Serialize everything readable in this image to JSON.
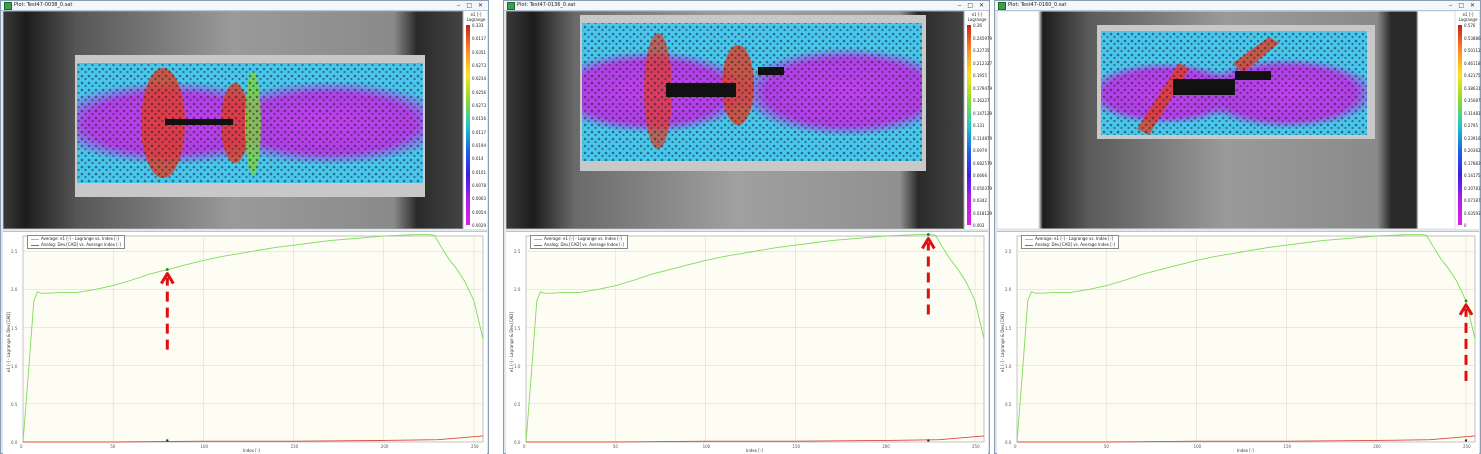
{
  "colors": {
    "curve": "#7fdc5a",
    "curve2": "#d94a3a",
    "arrow": "#e01010",
    "plot_bg": "#fdfdf4"
  },
  "panels": [
    {
      "window_title": "Plot: Test47-0038_0.sat",
      "legend": {
        "title": "e1 [-]",
        "subtitle": "Lagrange",
        "ticks": [
          "0.333",
          "0.0117",
          "0.0351",
          "0.0273",
          "0.0234",
          "0.0256",
          "0.0273",
          "0.0156",
          "0.0117",
          "0.0194",
          "0.014",
          "0.0101",
          "0.0078",
          "0.0063",
          "0.0054",
          "0.0029"
        ]
      },
      "plot": {
        "legend": [
          "Average: e1 [-] - Lagrange vs. Index [-]",
          "Analog: Dev.[CAD] vs. Average Index [-]"
        ],
        "ylabel": "e1 [-] - Lagrange & Dev.[CAD]",
        "xlabel": "Index [-]",
        "yticks": [
          "2.5",
          "2.0",
          "1.5",
          "1.0",
          "0.5",
          "0.0"
        ],
        "xticks": [
          "0",
          "50",
          "100",
          "150",
          "200",
          "250"
        ],
        "marker_index": 80
      }
    },
    {
      "window_title": "Plot: Test47-0136_0.sat",
      "legend": {
        "title": "e1 [-]",
        "subtitle": "Lagrange",
        "ticks": [
          "0.26",
          "0.245979",
          "0.22735",
          "0.212327",
          "0.1955",
          "0.179479",
          "0.16227",
          "0.147129",
          "0.131",
          "0.114879",
          "0.0979",
          "0.082579",
          "0.0666",
          "0.050379",
          "0.0342",
          "0.018129",
          "0.003"
        ]
      },
      "plot": {
        "legend": [
          "Average: e1 [-] - Lagrange vs. Index [-]",
          "Analog: Dev.[CAD] vs. Average Index [-]"
        ],
        "ylabel": "e1 [-] - Lagrange & Dev.[CAD]",
        "xlabel": "Index [-]",
        "yticks": [
          "2.5",
          "2.0",
          "1.5",
          "1.0",
          "0.5",
          "0.0"
        ],
        "xticks": [
          "0",
          "50",
          "100",
          "150",
          "200",
          "250"
        ],
        "marker_index": 224
      }
    },
    {
      "window_title": "Plot: Test47-0160_0.sat",
      "legend": {
        "title": "e1 [-]",
        "subtitle": "Lagrange",
        "ticks": [
          "0.576",
          "0.538862",
          "0.501125",
          "0.461187",
          "0.42175",
          "0.386312",
          "0.350875",
          "0.314837",
          "0.2795",
          "0.239162",
          "0.203625",
          "0.178839",
          "0.14175",
          "0.107812",
          "0.071875",
          "0.035937",
          "0"
        ]
      },
      "plot": {
        "legend": [
          "Average: e1 [-] - Lagrange vs. Index [-]",
          "Analog: Dev.[CAD] vs. Average Index [-]"
        ],
        "ylabel": "e1 [-] - Lagrange & Dev.[CAD]",
        "xlabel": "Index [-]",
        "yticks": [
          "2.5",
          "2.0",
          "1.5",
          "1.0",
          "0.5",
          "0.0"
        ],
        "xticks": [
          "0",
          "50",
          "100",
          "150",
          "200",
          "250"
        ],
        "marker_index": 250
      }
    }
  ],
  "chart_data": {
    "type": "line",
    "xlabel": "Index [-]",
    "ylabel": "e1 [-] - Lagrange & Dev.[CAD]",
    "xlim": [
      0,
      255
    ],
    "ylim": [
      0,
      2.7
    ],
    "series": [
      {
        "name": "Average: e1 [-] - Lagrange vs. Index [-]",
        "x": [
          0,
          3,
          6,
          8,
          10,
          15,
          20,
          30,
          40,
          50,
          60,
          70,
          80,
          90,
          100,
          110,
          120,
          130,
          140,
          150,
          160,
          170,
          180,
          190,
          200,
          210,
          220,
          225,
          228,
          232,
          236,
          240,
          245,
          250,
          255
        ],
        "y": [
          0.0,
          0.9,
          1.85,
          1.97,
          1.95,
          1.95,
          1.96,
          1.96,
          2.0,
          2.05,
          2.12,
          2.2,
          2.26,
          2.32,
          2.38,
          2.43,
          2.47,
          2.51,
          2.55,
          2.58,
          2.61,
          2.64,
          2.66,
          2.68,
          2.7,
          2.71,
          2.72,
          2.72,
          2.71,
          2.55,
          2.4,
          2.28,
          2.1,
          1.85,
          1.35
        ]
      },
      {
        "name": "Analog: Dev.[CAD] vs. Average Index [-]",
        "x": [
          0,
          50,
          100,
          150,
          200,
          230,
          245,
          255
        ],
        "y": [
          0.0,
          0.0,
          0.01,
          0.01,
          0.02,
          0.03,
          0.06,
          0.08
        ]
      }
    ]
  }
}
